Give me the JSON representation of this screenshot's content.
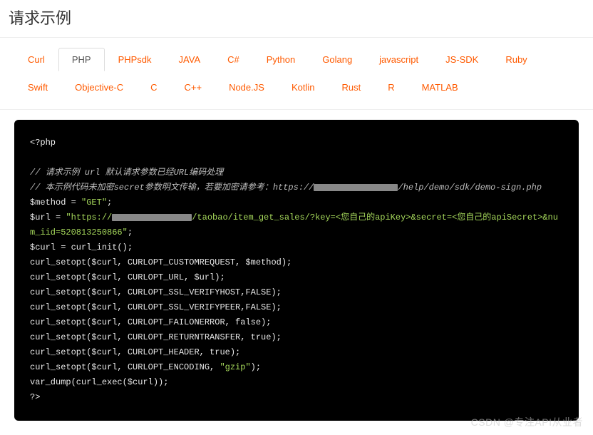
{
  "title": "请求示例",
  "tabs": {
    "items": [
      {
        "label": "Curl"
      },
      {
        "label": "PHP"
      },
      {
        "label": "PHPsdk"
      },
      {
        "label": "JAVA"
      },
      {
        "label": "C#"
      },
      {
        "label": "Python"
      },
      {
        "label": "Golang"
      },
      {
        "label": "javascript"
      },
      {
        "label": "JS-SDK"
      },
      {
        "label": "Ruby"
      },
      {
        "label": "Swift"
      },
      {
        "label": "Objective-C"
      },
      {
        "label": "C"
      },
      {
        "label": "C++"
      },
      {
        "label": "Node.JS"
      },
      {
        "label": "Kotlin"
      },
      {
        "label": "Rust"
      },
      {
        "label": ".R"
      },
      {
        "label": "MATLAB"
      }
    ],
    "active_index": 1
  },
  "code": {
    "open": "<?php",
    "comment1": "// 请求示例 url 默认请求参数已经URL编码处理",
    "comment2a": "// 本示例代码未加密secret参数明文传输，若要加密请参考：https://",
    "comment2b": "/help/demo/sdk/demo-sign.php",
    "l1a": "$method = ",
    "l1b": "\"GET\"",
    "l1c": ";",
    "l2a": "$url = ",
    "l2b1": "\"https://",
    "l2b2": "/taobao/item_get_sales/?key=<您自己的apiKey>&secret=<您自己的apiSecret>&num_iid=520813250866\"",
    "l2c": ";",
    "l3": "$curl = curl_init();",
    "l4": "curl_setopt($curl, CURLOPT_CUSTOMREQUEST, $method);",
    "l5": "curl_setopt($curl, CURLOPT_URL, $url);",
    "l6": "curl_setopt($curl, CURLOPT_SSL_VERIFYHOST,FALSE);",
    "l7": "curl_setopt($curl, CURLOPT_SSL_VERIFYPEER,FALSE);",
    "l8a": "curl_setopt($curl, CURLOPT_FAILONERROR, ",
    "l8b": "false",
    "l8c": ");",
    "l9a": "curl_setopt($curl, CURLOPT_RETURNTRANSFER, ",
    "l9b": "true",
    "l9c": ");",
    "l10a": "curl_setopt($curl, CURLOPT_HEADER, ",
    "l10b": "true",
    "l10c": ");",
    "l11a": "curl_setopt($curl, CURLOPT_ENCODING, ",
    "l11b": "\"gzip\"",
    "l11c": ");",
    "l12": "var_dump(curl_exec($curl));",
    "l13": "?>"
  },
  "watermark": "CSDN @专注API从业者"
}
